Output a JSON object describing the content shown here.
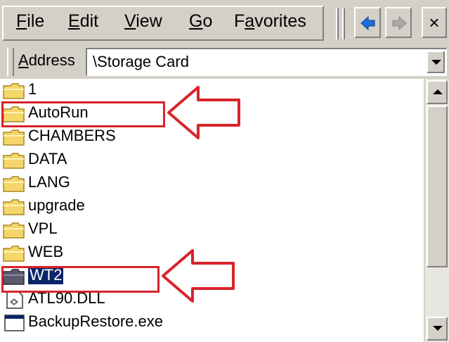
{
  "menu": {
    "file": {
      "accel": "F",
      "rest": "ile"
    },
    "edit": {
      "accel": "E",
      "rest": "dit"
    },
    "view": {
      "accel": "V",
      "rest": "iew"
    },
    "go": {
      "accel": "G",
      "rest": "o"
    },
    "favorites": {
      "pre": "F",
      "accel": "a",
      "rest": "vorites"
    }
  },
  "toolbar": {
    "back_icon": "back-arrow-icon",
    "forward_icon": "forward-arrow-icon",
    "close_label": "×"
  },
  "address": {
    "accel": "A",
    "rest": "ddress",
    "value": "\\Storage Card"
  },
  "files": [
    {
      "name": "1",
      "icon": "folder-icon"
    },
    {
      "name": "AutoRun",
      "icon": "folder-icon"
    },
    {
      "name": "CHAMBERS",
      "icon": "folder-icon"
    },
    {
      "name": "DATA",
      "icon": "folder-icon"
    },
    {
      "name": "LANG",
      "icon": "folder-icon"
    },
    {
      "name": "upgrade",
      "icon": "folder-icon"
    },
    {
      "name": "VPL",
      "icon": "folder-icon"
    },
    {
      "name": "WEB",
      "icon": "folder-icon"
    },
    {
      "name": "WT2",
      "icon": "folder-icon",
      "selected": true
    },
    {
      "name": "ATL90.DLL",
      "icon": "dll-file-icon"
    },
    {
      "name": "BackupRestore.exe",
      "icon": "exe-file-icon"
    }
  ],
  "colors": {
    "highlight": "#d9232b",
    "selection": "#0a246a",
    "folder": "#f5d66b"
  }
}
